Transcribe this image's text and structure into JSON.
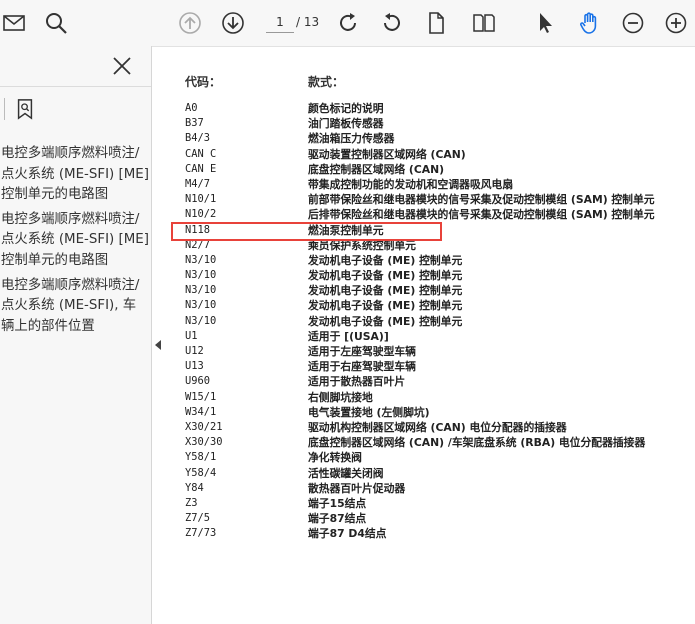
{
  "toolbar": {
    "page_current": "1",
    "page_total": "/ 13"
  },
  "sidebar": {
    "items": [
      {
        "label": "电控多端顺序燃料喷注/点火系统 (ME-SFI) [ME] 控制单元的电路图"
      },
      {
        "label": "电控多端顺序燃料喷注/点火系统 (ME-SFI) [ME] 控制单元的电路图"
      },
      {
        "label": "电控多端顺序燃料喷注/点火系统 (ME-SFI), 车辆上的部件位置"
      }
    ]
  },
  "document": {
    "header_code": "代码：",
    "header_desc": "款式：",
    "rows": [
      {
        "code": "A0",
        "desc": "颜色标记的说明"
      },
      {
        "code": "B37",
        "desc": "油门踏板传感器"
      },
      {
        "code": "B4/3",
        "desc": "燃油箱压力传感器"
      },
      {
        "code": "CAN C",
        "desc": "驱动装置控制器区域网络 (CAN)"
      },
      {
        "code": "CAN E",
        "desc": "底盘控制器区域网络 (CAN)"
      },
      {
        "code": "M4/7",
        "desc": "带集成控制功能的发动机和空调器吸风电扇"
      },
      {
        "code": "N10/1",
        "desc": "前部带保险丝和继电器模块的信号采集及促动控制模组 (SAM) 控制单元"
      },
      {
        "code": "N10/2",
        "desc": "后排带保险丝和继电器模块的信号采集及促动控制模组 (SAM) 控制单元"
      },
      {
        "code": "N118",
        "desc": "燃油泵控制单元"
      },
      {
        "code": "N2/7",
        "desc": "乘员保护系统控制单元"
      },
      {
        "code": "N3/10",
        "desc": "发动机电子设备 (ME) 控制单元"
      },
      {
        "code": "N3/10",
        "desc": "发动机电子设备 (ME) 控制单元"
      },
      {
        "code": "N3/10",
        "desc": "发动机电子设备 (ME) 控制单元"
      },
      {
        "code": "N3/10",
        "desc": "发动机电子设备 (ME) 控制单元"
      },
      {
        "code": "N3/10",
        "desc": "发动机电子设备 (ME) 控制单元"
      },
      {
        "code": "U1",
        "desc": "适用于 [(USA)]"
      },
      {
        "code": "U12",
        "desc": "适用于左座驾驶型车辆"
      },
      {
        "code": "U13",
        "desc": "适用于右座驾驶型车辆"
      },
      {
        "code": "U960",
        "desc": "适用于散热器百叶片"
      },
      {
        "code": "W15/1",
        "desc": "右侧脚坑接地"
      },
      {
        "code": "W34/1",
        "desc": "电气装置接地 (左侧脚坑)"
      },
      {
        "code": "X30/21",
        "desc": "驱动机构控制器区域网络 (CAN) 电位分配器的插接器"
      },
      {
        "code": "X30/30",
        "desc": "底盘控制器区域网络 (CAN) /车架底盘系统 (RBA) 电位分配器插接器"
      },
      {
        "code": "Y58/1",
        "desc": "净化转换阀"
      },
      {
        "code": "Y58/4",
        "desc": "活性碳罐关闭阀"
      },
      {
        "code": "Y84",
        "desc": "散热器百叶片促动器"
      },
      {
        "code": "Z3",
        "desc": "端子15结点"
      },
      {
        "code": "Z7/5",
        "desc": "端子87结点"
      },
      {
        "code": "Z7/73",
        "desc": "端子87 D4结点"
      }
    ]
  },
  "colors": {
    "highlight": "#e8423a",
    "accent_hand": "#1a73e8"
  }
}
